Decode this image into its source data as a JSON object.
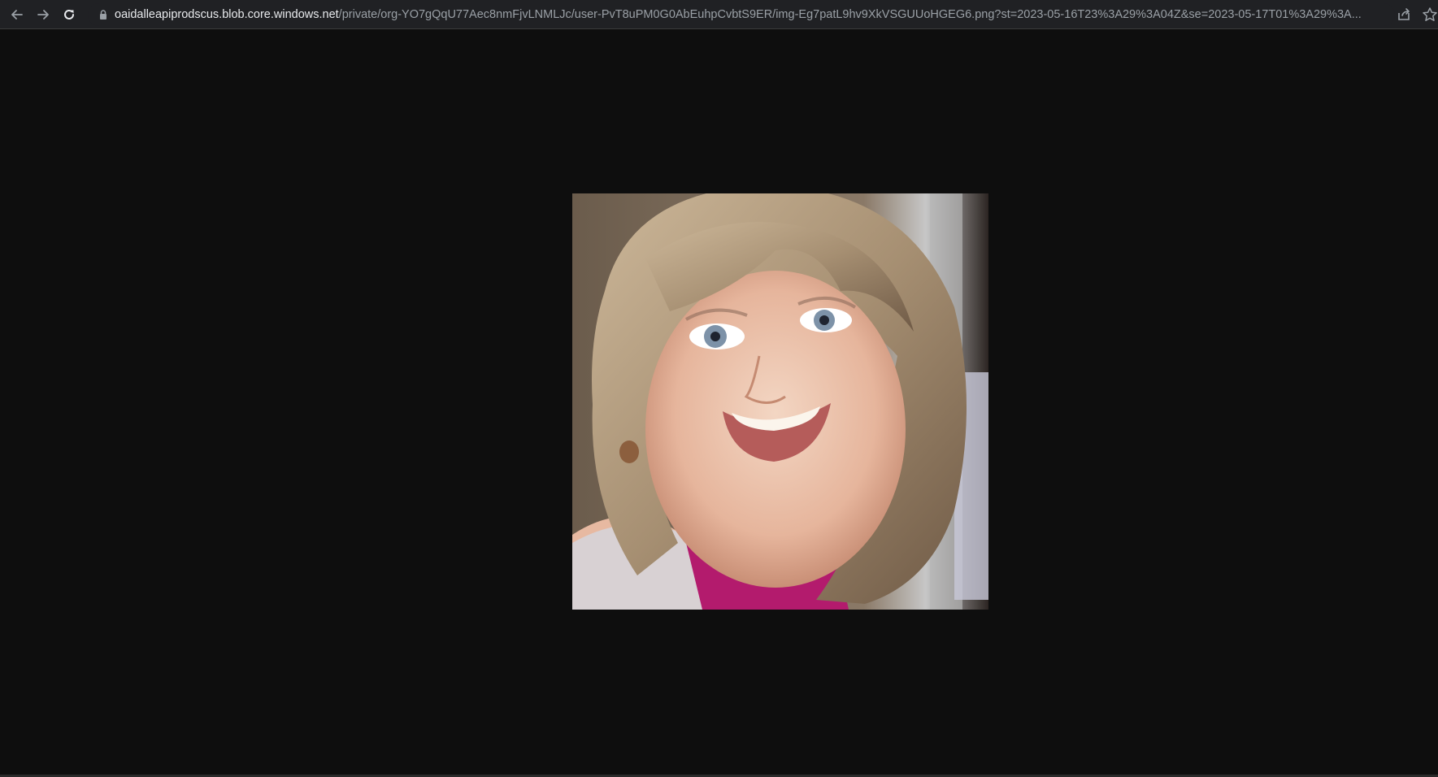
{
  "browser": {
    "back_icon": "arrow-left-icon",
    "forward_icon": "arrow-right-icon",
    "reload_icon": "reload-icon",
    "lock_icon": "lock-icon",
    "share_icon": "share-icon",
    "bookmark_icon": "star-icon",
    "url_host": "oaidalleapiprodscus.blob.core.windows.net",
    "url_path": "/private/org-YO7gQqU77Aec8nmFjvLNMLJc/user-PvT8uPM0G0AbEuhpCvbtS9ER/img-Eg7patL9hv9XkVSGUUoHGEG6.png?st=2023-05-16T23%3A29%3A04Z&se=2023-05-17T01%3A29%3A..."
  },
  "content": {
    "image_type": "photo"
  },
  "colors": {
    "page_background": "#0e0e0e",
    "toolbar_background": "#202124",
    "url_host_color": "#e8eaed",
    "url_path_color": "#9aa0a6"
  }
}
